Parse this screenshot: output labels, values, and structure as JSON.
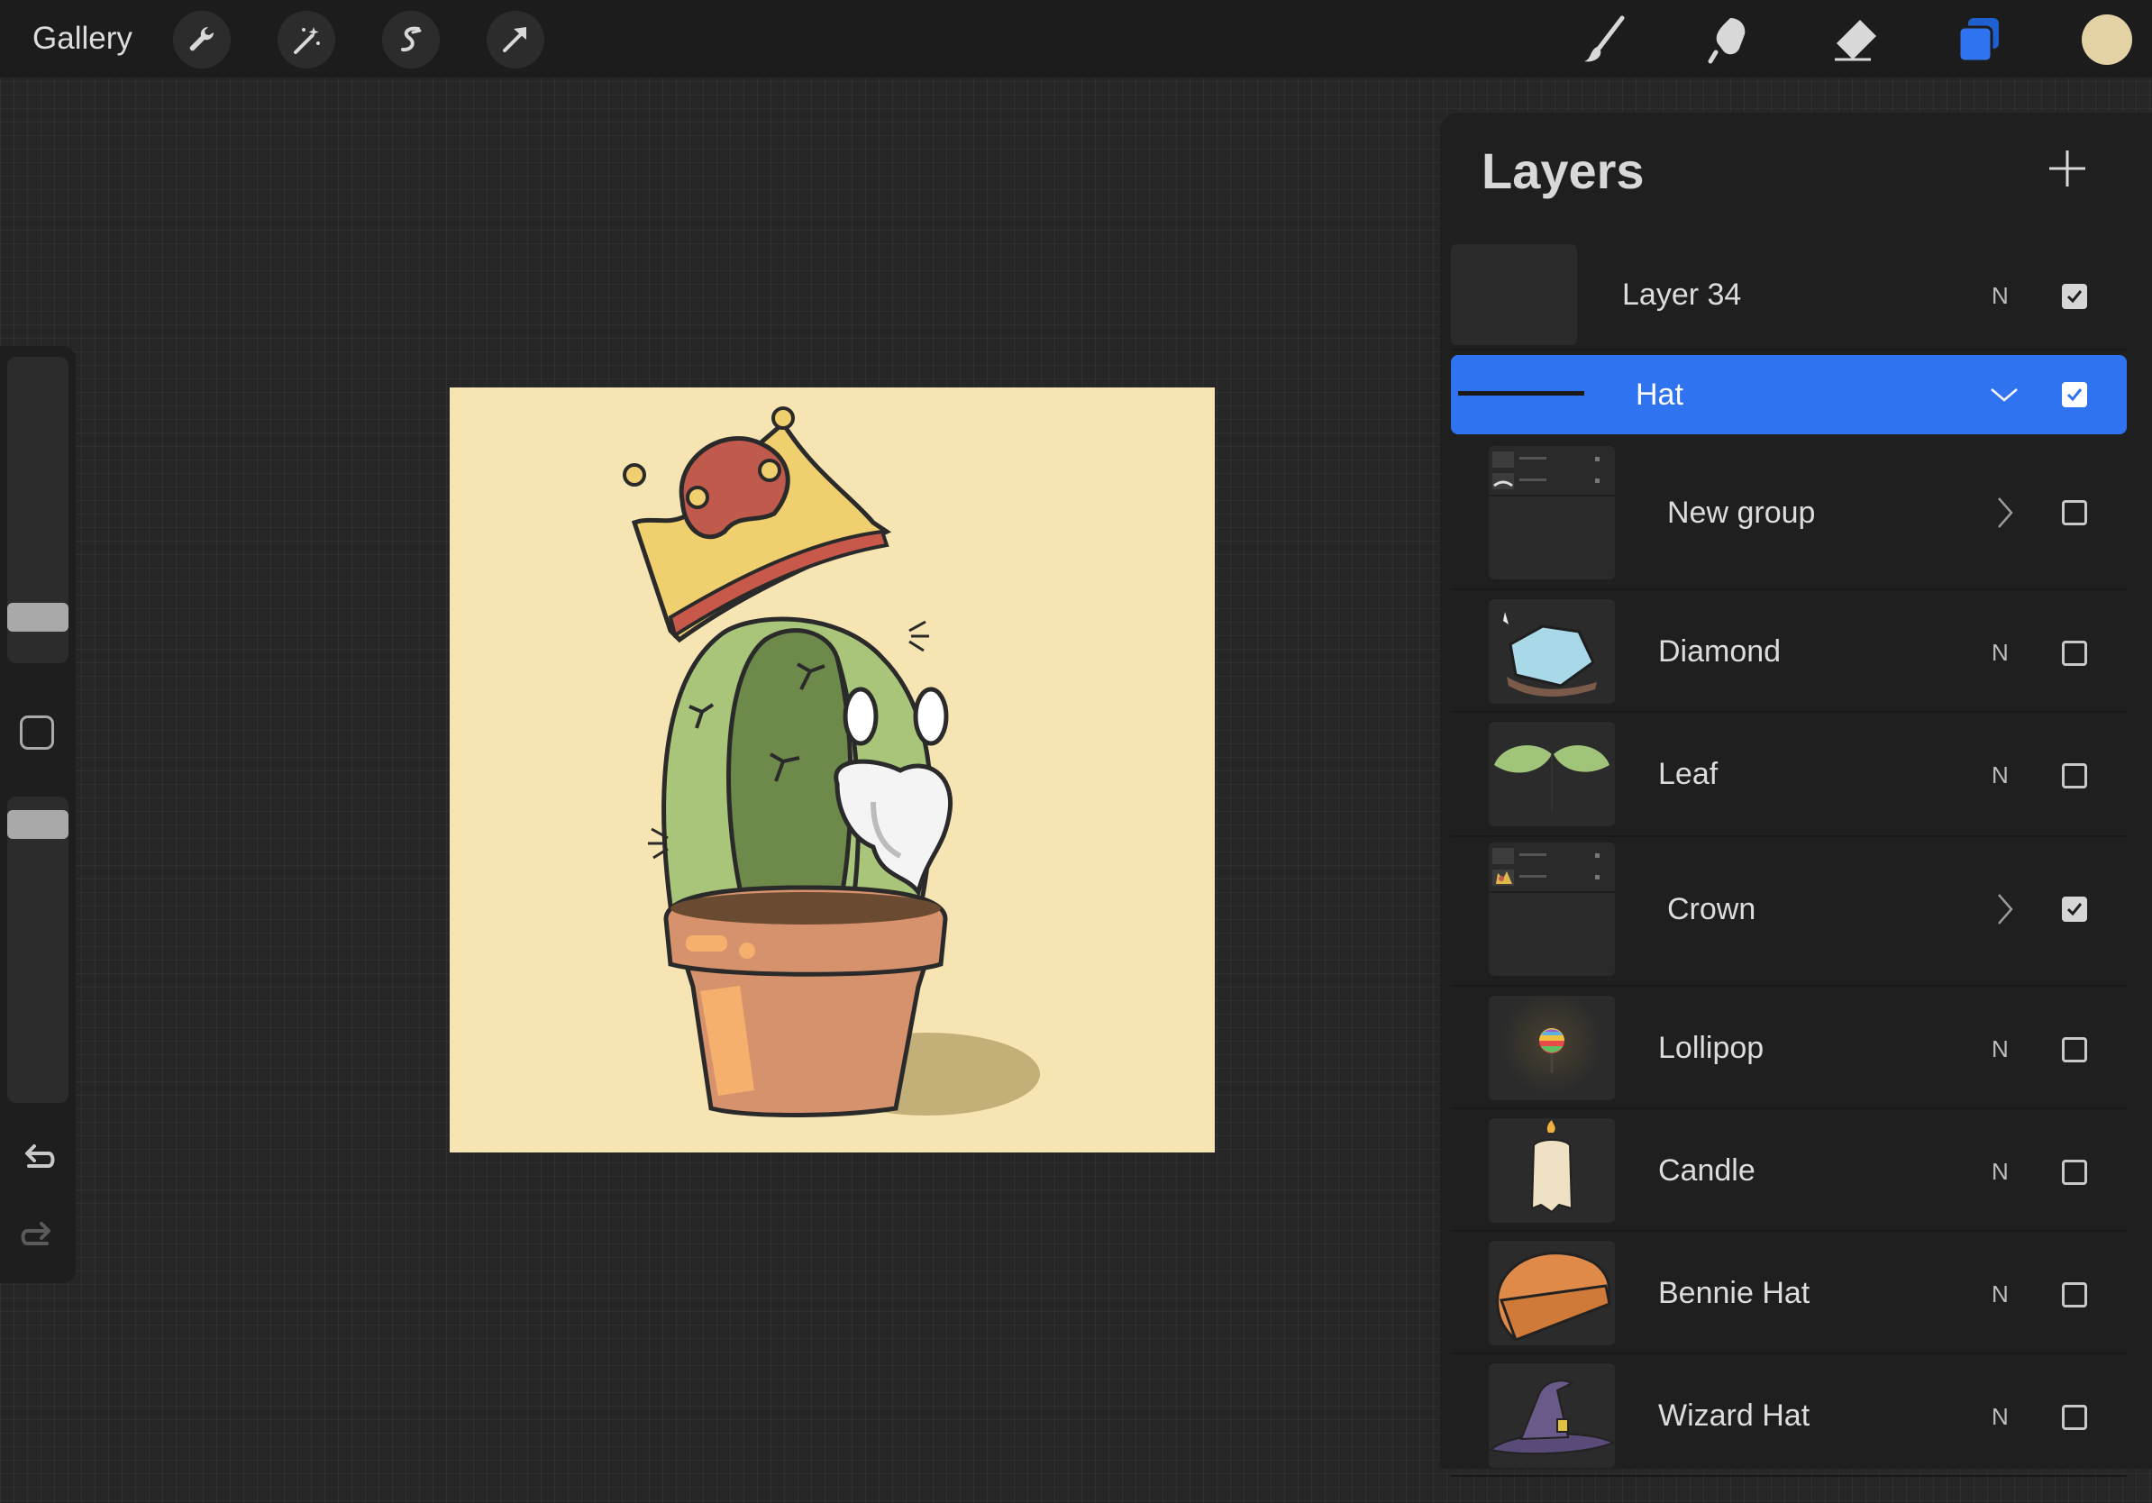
{
  "topbar": {
    "gallery_label": "Gallery",
    "left_tools": [
      "wrench-icon",
      "magic-wand-icon",
      "selection-s-icon",
      "transform-arrow-icon"
    ],
    "right_tools": [
      "brush-icon",
      "smudge-icon",
      "eraser-icon",
      "layers-icon"
    ],
    "current_color": "#e3d3a4",
    "accent_color": "#2f73f0"
  },
  "sidebar": {
    "controls": [
      "brush-size-slider",
      "modify-button",
      "opacity-slider",
      "undo-icon",
      "redo-icon"
    ]
  },
  "canvas": {
    "background_color": "#f6e5b3",
    "subject": "cactus-illustration"
  },
  "layers_panel": {
    "title": "Layers",
    "add_icon": "plus-icon",
    "layers": [
      {
        "name": "Layer 34",
        "mode": "N",
        "visible": true,
        "kind": "layer"
      },
      {
        "name": "Hat",
        "mode": "",
        "visible": true,
        "kind": "group-open",
        "selected": true
      },
      {
        "name": "New group",
        "mode": "",
        "visible": false,
        "kind": "group-closed"
      },
      {
        "name": "Diamond",
        "mode": "N",
        "visible": false,
        "kind": "layer"
      },
      {
        "name": "Leaf",
        "mode": "N",
        "visible": false,
        "kind": "layer"
      },
      {
        "name": "Crown",
        "mode": "",
        "visible": true,
        "kind": "group-closed"
      },
      {
        "name": "Lollipop",
        "mode": "N",
        "visible": false,
        "kind": "layer"
      },
      {
        "name": "Candle",
        "mode": "N",
        "visible": false,
        "kind": "layer"
      },
      {
        "name": "Bennie Hat",
        "mode": "N",
        "visible": false,
        "kind": "layer"
      },
      {
        "name": "Wizard Hat",
        "mode": "N",
        "visible": false,
        "kind": "layer"
      }
    ]
  }
}
